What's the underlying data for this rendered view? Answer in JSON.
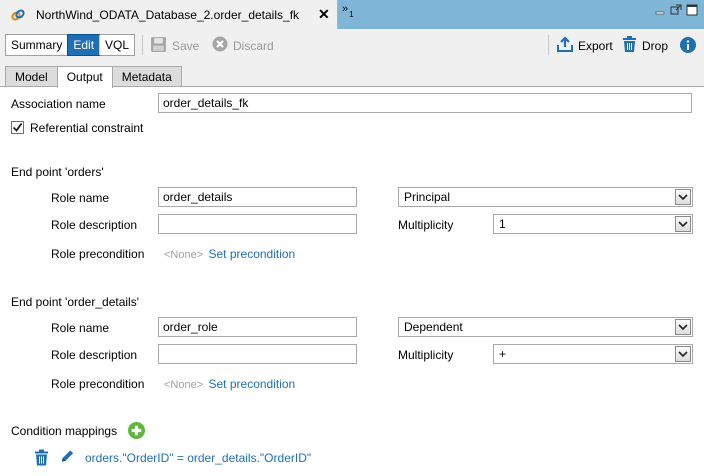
{
  "tab": {
    "title": "NorthWind_ODATA_Database_2.order_details_fk",
    "overflow_count": "1"
  },
  "toolbar": {
    "summary": "Summary",
    "edit": "Edit",
    "vql": "VQL",
    "save": "Save",
    "discard": "Discard",
    "export": "Export",
    "drop": "Drop"
  },
  "subtabs": [
    "Model",
    "Output",
    "Metadata"
  ],
  "form": {
    "association_name_label": "Association name",
    "association_name_value": "order_details_fk",
    "referential_constraint_label": "Referential constraint",
    "referential_constraint_checked": true,
    "endpoints": [
      {
        "header": "End point 'orders'",
        "role_name_label": "Role name",
        "role_name_value": "order_details",
        "role_type_value": "Principal",
        "role_description_label": "Role description",
        "role_description_value": "",
        "multiplicity_label": "Multiplicity",
        "multiplicity_value": "1",
        "role_precondition_label": "Role precondition",
        "precondition_none": "<None>",
        "set_precondition": "Set precondition"
      },
      {
        "header": "End point 'order_details'",
        "role_name_label": "Role name",
        "role_name_value": "order_role",
        "role_type_value": "Dependent",
        "role_description_label": "Role description",
        "role_description_value": "",
        "multiplicity_label": "Multiplicity",
        "multiplicity_value": "+",
        "role_precondition_label": "Role precondition",
        "precondition_none": "<None>",
        "set_precondition": "Set precondition"
      }
    ],
    "condition_mappings_label": "Condition mappings",
    "mappings": [
      "orders.\"OrderID\" = order_details.\"OrderID\""
    ]
  },
  "colors": {
    "accent": "#1f6fb5",
    "titlebar": "#7fb6d8",
    "add": "#5cb83c"
  }
}
